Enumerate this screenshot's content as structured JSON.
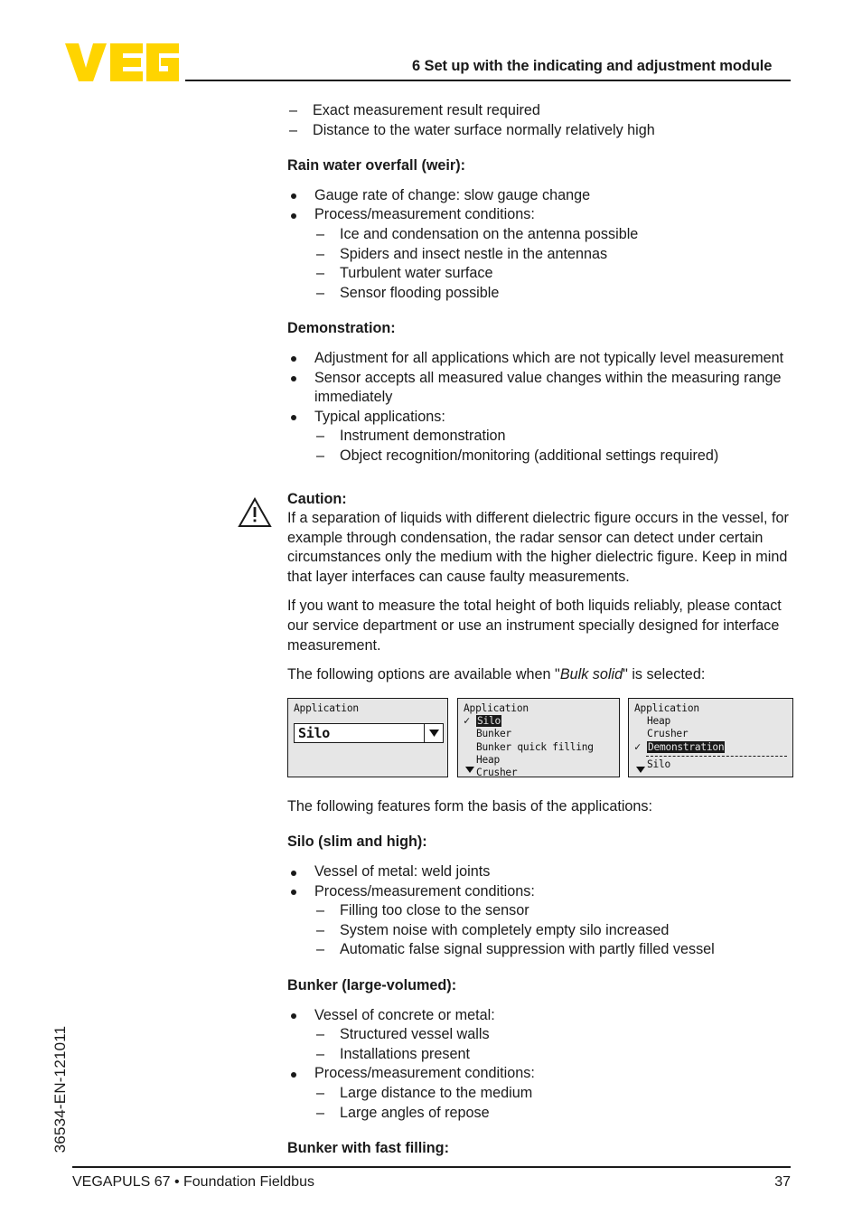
{
  "header": {
    "logo_alt": "VEGA",
    "logo_color": "#FFD400",
    "title": "6 Set up with the indicating and adjustment module"
  },
  "footer": {
    "left": "VEGAPULS 67 • Foundation Fieldbus",
    "page_number": "37",
    "doc_code": "36534-EN-121011"
  },
  "content": {
    "top_dashes": [
      "Exact measurement result required",
      "Distance to the water surface normally relatively high"
    ],
    "rain_water": {
      "heading": "Rain water overfall (weir):",
      "bullets": [
        "Gauge rate of change: slow gauge change",
        "Process/measurement conditions:"
      ],
      "sub_dashes": [
        "Ice and condensation on the antenna possible",
        "Spiders and insect nestle in the antennas",
        "Turbulent water surface",
        "Sensor flooding possible"
      ]
    },
    "demonstration": {
      "heading": "Demonstration:",
      "bullets": [
        "Adjustment for all applications which are not typically level measurement",
        "Sensor accepts all measured value changes within the measuring range immediately",
        "Typical applications:"
      ],
      "sub_dashes": [
        "Instrument demonstration",
        "Object recognition/monitoring (additional settings required)"
      ]
    },
    "caution": {
      "icon": "warning-triangle-icon",
      "heading": "Caution:",
      "paragraph_1": "If a separation of liquids with different dielectric figure occurs in the vessel, for example through condensation, the radar sensor can detect under certain circumstances only the medium with the higher dielectric figure. Keep in mind that layer interfaces can cause faulty measurements.",
      "paragraph_2": "If you want to measure the total height of both liquids reliably, please contact our service department or use an instrument specially designed for interface measurement.",
      "paragraph_3_prefix": "The following options are available when \"",
      "paragraph_3_italic": "Bulk solid",
      "paragraph_3_suffix": "\" is selected:"
    },
    "lcd_displays": [
      {
        "id": "lcd-1",
        "title": "Application",
        "type": "dropdown-closed",
        "field_value": "Silo",
        "arrow": "▼"
      },
      {
        "id": "lcd-2",
        "title": "Application",
        "type": "list",
        "items": [
          {
            "label": "Silo",
            "checked": true,
            "selected": true
          },
          {
            "label": "Bunker",
            "checked": false,
            "selected": false
          },
          {
            "label": "Bunker quick filling",
            "checked": false,
            "selected": false
          },
          {
            "label": "Heap",
            "checked": false,
            "selected": false
          },
          {
            "label": "Crusher",
            "checked": false,
            "selected": false
          }
        ],
        "scroll_down": "▼"
      },
      {
        "id": "lcd-3",
        "title": "Application",
        "type": "list",
        "items": [
          {
            "label": "Heap",
            "checked": false,
            "selected": false
          },
          {
            "label": "Crusher",
            "checked": false,
            "selected": false
          },
          {
            "label": "Demonstration",
            "checked": true,
            "selected": true
          },
          {
            "separator": true
          },
          {
            "label": "Silo",
            "checked": false,
            "selected": false
          }
        ],
        "scroll_down": "▼"
      }
    ],
    "features_intro": "The following features form the basis of the applications:",
    "silo": {
      "heading": "Silo (slim and high):",
      "bullets": [
        "Vessel of metal: weld joints",
        "Process/measurement conditions:"
      ],
      "sub_dashes": [
        "Filling too close to the sensor",
        "System noise with completely empty silo increased",
        "Automatic false signal suppression with partly filled vessel"
      ]
    },
    "bunker": {
      "heading": "Bunker (large-volumed):",
      "bullet_1": "Vessel of concrete or metal:",
      "sub_dashes_1": [
        "Structured vessel walls",
        "Installations present"
      ],
      "bullet_2": "Process/measurement conditions:",
      "sub_dashes_2": [
        "Large distance to the medium",
        "Large angles of repose"
      ]
    },
    "bunker_fast": {
      "heading": "Bunker with fast filling:"
    }
  }
}
